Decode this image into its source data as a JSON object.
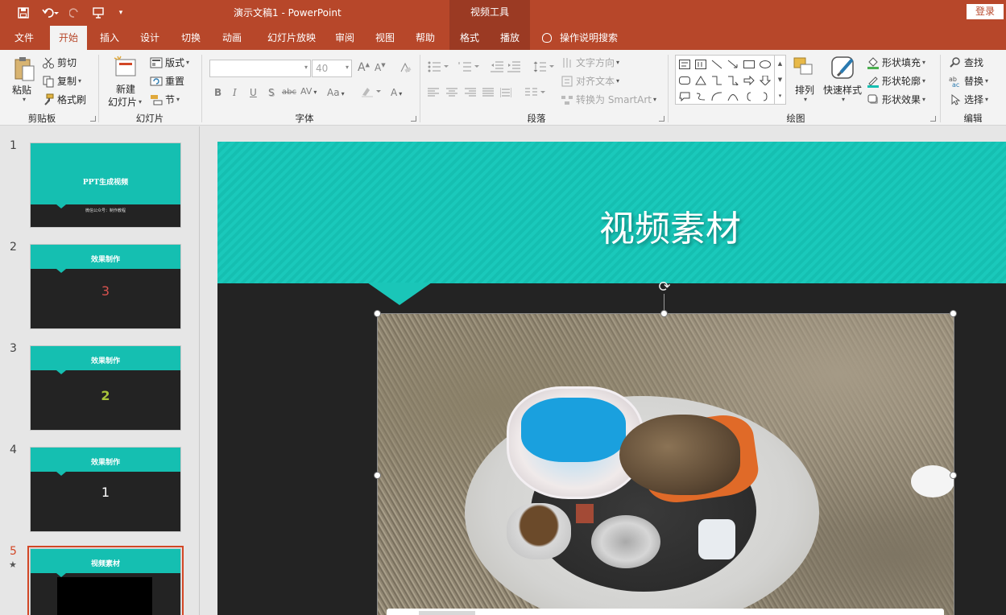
{
  "titlebar": {
    "doc_title": "演示文稿1  -  PowerPoint",
    "context_group": "视频工具",
    "login": "登录",
    "customize_glyph": "▾"
  },
  "tabs": [
    {
      "label": "文件"
    },
    {
      "label": "开始"
    },
    {
      "label": "插入"
    },
    {
      "label": "设计"
    },
    {
      "label": "切换"
    },
    {
      "label": "动画"
    },
    {
      "label": "幻灯片放映"
    },
    {
      "label": "审阅"
    },
    {
      "label": "视图"
    },
    {
      "label": "帮助"
    },
    {
      "label": "格式"
    },
    {
      "label": "播放"
    }
  ],
  "tellme": "操作说明搜索",
  "ribbon": {
    "clipboard": {
      "label": "剪贴板",
      "paste": "粘贴",
      "cut": "剪切",
      "copy": "复制",
      "format_painter": "格式刷"
    },
    "slides": {
      "label": "幻灯片",
      "new_slide_1": "新建",
      "new_slide_2": "幻灯片",
      "layout": "版式",
      "reset": "重置",
      "section": "节"
    },
    "font": {
      "label": "字体",
      "size": "40",
      "bold": "B",
      "italic": "I",
      "underline": "U",
      "shadow": "S",
      "strike": "abc",
      "spacing": "AV",
      "case": "Aa",
      "color": "A",
      "grow": "A",
      "shrink": "A"
    },
    "paragraph": {
      "label": "段落",
      "text_direction": "文字方向",
      "align_text": "对齐文本",
      "smartart": "转换为 SmartArt"
    },
    "drawing": {
      "label": "绘图",
      "arrange": "排列",
      "quick_styles": "快速样式",
      "fill": "形状填充",
      "outline": "形状轮廓",
      "effects": "形状效果"
    },
    "editing": {
      "label": "编辑",
      "find": "查找",
      "replace": "替换",
      "select": "选择"
    }
  },
  "slides": [
    {
      "num": "1",
      "title": "PPT生成视频",
      "sub": "微信公众号：制作教程",
      "num_text": ""
    },
    {
      "num": "2",
      "title": "效果制作",
      "num_text": "3"
    },
    {
      "num": "3",
      "title": "效果制作",
      "num_text": "2"
    },
    {
      "num": "4",
      "title": "效果制作",
      "num_text": "1"
    },
    {
      "num": "5",
      "title": "视频素材",
      "num_text": "",
      "star": "★"
    }
  ],
  "current_slide": {
    "title": "视频素材"
  },
  "colors": {
    "brand": "#b7472a",
    "teal": "#15bfb1",
    "slide_dark": "#232323",
    "num2": "#d9534f",
    "num3": "#a8c43a"
  }
}
